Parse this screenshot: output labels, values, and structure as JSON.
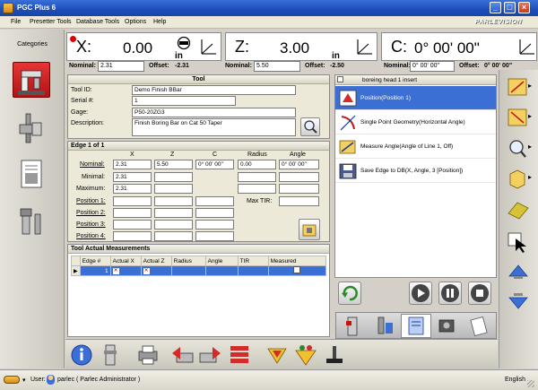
{
  "window": {
    "title": "PGC Plus 6"
  },
  "menu": {
    "items": [
      "File",
      "Presetter Tools",
      "Database Tools",
      "Options",
      "Help"
    ],
    "brand": "PARLEVISION"
  },
  "categories": {
    "label": "Categories"
  },
  "readout": {
    "x": {
      "axis": "X:",
      "value": "0.00",
      "unit": "in"
    },
    "z": {
      "axis": "Z:",
      "value": "3.00",
      "unit": "in"
    },
    "c": {
      "axis": "C:",
      "value": "0° 00' 00\""
    }
  },
  "nominals": {
    "label": "Nominal:",
    "offset_label": "Offset:",
    "x_nominal": "2.31",
    "x_offset": "-2.31",
    "z_nominal": "5.50",
    "z_offset": "-2.50",
    "c_nominal": "0° 00' 00\"",
    "c_offset": "0° 00' 00\""
  },
  "tool": {
    "header": "Tool",
    "id_label": "Tool ID:",
    "id": "Demo Finish BBar",
    "serial_label": "Serial #:",
    "serial": "1",
    "gage_label": "Gage:",
    "gage": "P50-20ZG3",
    "desc_label": "Description:",
    "desc": "Finish Boring Bar on Cat 50 Taper"
  },
  "edge": {
    "header": "Edge 1 of 1",
    "columns": [
      "X",
      "Z",
      "C",
      "Radius",
      "Angle"
    ],
    "nominal_label": "Nominal:",
    "minimal_label": "Minimal:",
    "maximum_label": "Maximum:",
    "nominal": [
      "2.31",
      "5.50",
      "0° 00' 00\"",
      "0.00",
      "0° 00' 00\""
    ],
    "minimal": [
      "2.31"
    ],
    "maximum": [
      "2.31"
    ],
    "positions": [
      "Position 1:",
      "Position 2:",
      "Position 3:",
      "Position 4:"
    ],
    "max_tir_label": "Max TIR:"
  },
  "measurements": {
    "header": "Tool Actual Measurements",
    "columns": [
      "Edge #",
      "Actual X",
      "Actual Z",
      "Radius",
      "Angle",
      "TIR",
      "Measured"
    ],
    "rows": [
      {
        "edge": "1"
      }
    ]
  },
  "sequence": {
    "header": "boreing head 1 insert",
    "items": [
      "Position(Position 1)",
      "Single Point Geometry(Horizontal Angle)",
      "Measure Angle(Angle of Line 1, Off)",
      "Save Edge to DB(X, Angle, 3 [Position])"
    ]
  },
  "status": {
    "user_label": "User:",
    "user": "parlec ( Parlec Administrator )",
    "language": "English"
  }
}
